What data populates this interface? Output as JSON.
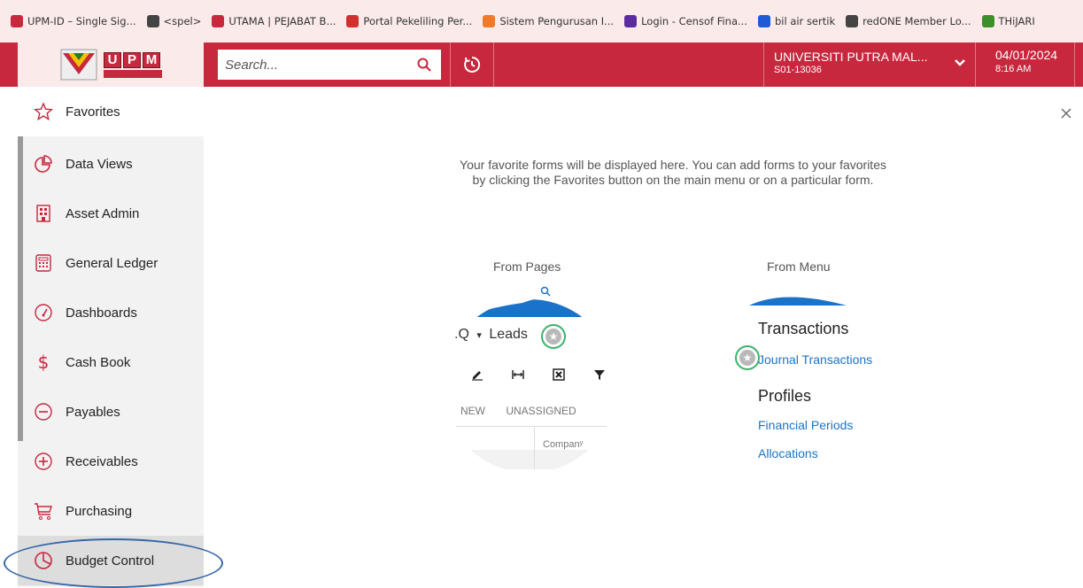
{
  "bookmarks": [
    {
      "label": "UPM-ID – Single Sig...",
      "icon": "upm-id-icon",
      "color": "#c8283e"
    },
    {
      "label": "<spel>",
      "icon": "globe-icon",
      "color": "#444444"
    },
    {
      "label": "UTAMA | PEJABAT B...",
      "icon": "upm-shield-icon",
      "color": "#c8283e"
    },
    {
      "label": "Portal Pekeliling Per...",
      "icon": "b-icon",
      "color": "#d32f2f"
    },
    {
      "label": "Sistem Pengurusan I...",
      "icon": "xampp-icon",
      "color": "#f07a2a"
    },
    {
      "label": "Login - Censof Fina...",
      "icon": "censof-icon",
      "color": "#5b2ca0"
    },
    {
      "label": "bil air sertik",
      "icon": "ui-icon",
      "color": "#1e5bd6"
    },
    {
      "label": "redONE Member Lo...",
      "icon": "globe-icon",
      "color": "#444444"
    },
    {
      "label": "THiJARI",
      "icon": "thijari-icon",
      "color": "#3d8f2a"
    }
  ],
  "header": {
    "search_placeholder": "Search...",
    "company_name": "UNIVERSITI PUTRA MAL...",
    "company_code": "S01-13036",
    "date": "04/01/2024",
    "time": "8:16 AM",
    "logo_letters": [
      "U",
      "P",
      "M"
    ],
    "accent_color": "#c8283e"
  },
  "sidebar": {
    "items": [
      {
        "label": "Favorites",
        "icon": "star-icon"
      },
      {
        "label": "Data Views",
        "icon": "pie-chart-icon"
      },
      {
        "label": "Asset Admin",
        "icon": "building-icon"
      },
      {
        "label": "General Ledger",
        "icon": "calculator-icon"
      },
      {
        "label": "Dashboards",
        "icon": "gauge-icon"
      },
      {
        "label": "Cash Book",
        "icon": "dollar-icon"
      },
      {
        "label": "Payables",
        "icon": "minus-circle-icon"
      },
      {
        "label": "Receivables",
        "icon": "plus-circle-icon"
      },
      {
        "label": "Purchasing",
        "icon": "cart-icon"
      },
      {
        "label": "Budget Control",
        "icon": "pie-slice-icon"
      }
    ]
  },
  "main": {
    "message_line1": "Your favorite forms will be displayed here. You can add forms to your favorites",
    "message_line2": "by clicking the Favorites button on the main menu or on a particular form.",
    "from_pages": {
      "title": "From Pages",
      "breadcrumb": ".Q",
      "screen_title": "Leads",
      "tabs": [
        "NEW",
        "UNASSIGNED"
      ],
      "column_header": "Companʸ"
    },
    "from_menu": {
      "title": "From Menu",
      "section1": "Transactions",
      "link1": "Journal Transactions",
      "section2": "Profiles",
      "link2": "Financial Periods",
      "link3": "Allocations"
    }
  }
}
